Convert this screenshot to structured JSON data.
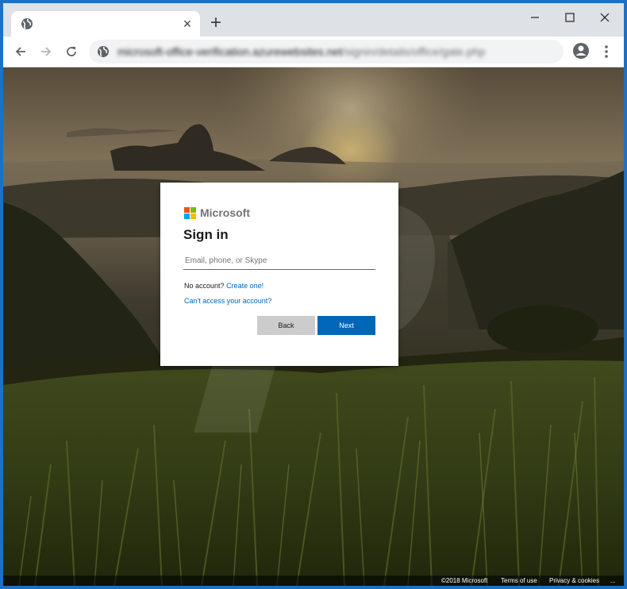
{
  "browser": {
    "tab": {
      "favicon": "globe-icon",
      "close_icon": "close-icon",
      "close_label": "×"
    },
    "new_tab_label": "+",
    "window_controls": [
      "minimize-icon",
      "maximize-icon",
      "close-icon"
    ],
    "toolbar": {
      "back_icon": "arrow-left-icon",
      "forward_icon": "arrow-right-icon",
      "reload_icon": "reload-icon",
      "site_icon": "globe-icon",
      "url_host": "microsoft-office-verification.azurewebsites.net",
      "url_path": "/signin/details/office/gate.php",
      "account_icon": "account-circle-icon",
      "menu_icon": "kebab-menu-icon"
    }
  },
  "signin": {
    "brand": "Microsoft",
    "title": "Sign in",
    "email_placeholder": "Email, phone, or Skype",
    "no_account_text": "No account?",
    "create_link": "Create one!",
    "cant_access_link": "Can't access your account?",
    "back_label": "Back",
    "next_label": "Next",
    "colors": {
      "link": "#0067b8",
      "primary_button": "#0067b8",
      "secondary_button": "#cccccc",
      "logo_red": "#f25022",
      "logo_green": "#7fba00",
      "logo_blue": "#00a4ef",
      "logo_yellow": "#ffb900"
    }
  },
  "footer": {
    "copyright": "©2018 Microsoft",
    "terms": "Terms of use",
    "privacy": "Privacy & cookies",
    "more": "..."
  }
}
